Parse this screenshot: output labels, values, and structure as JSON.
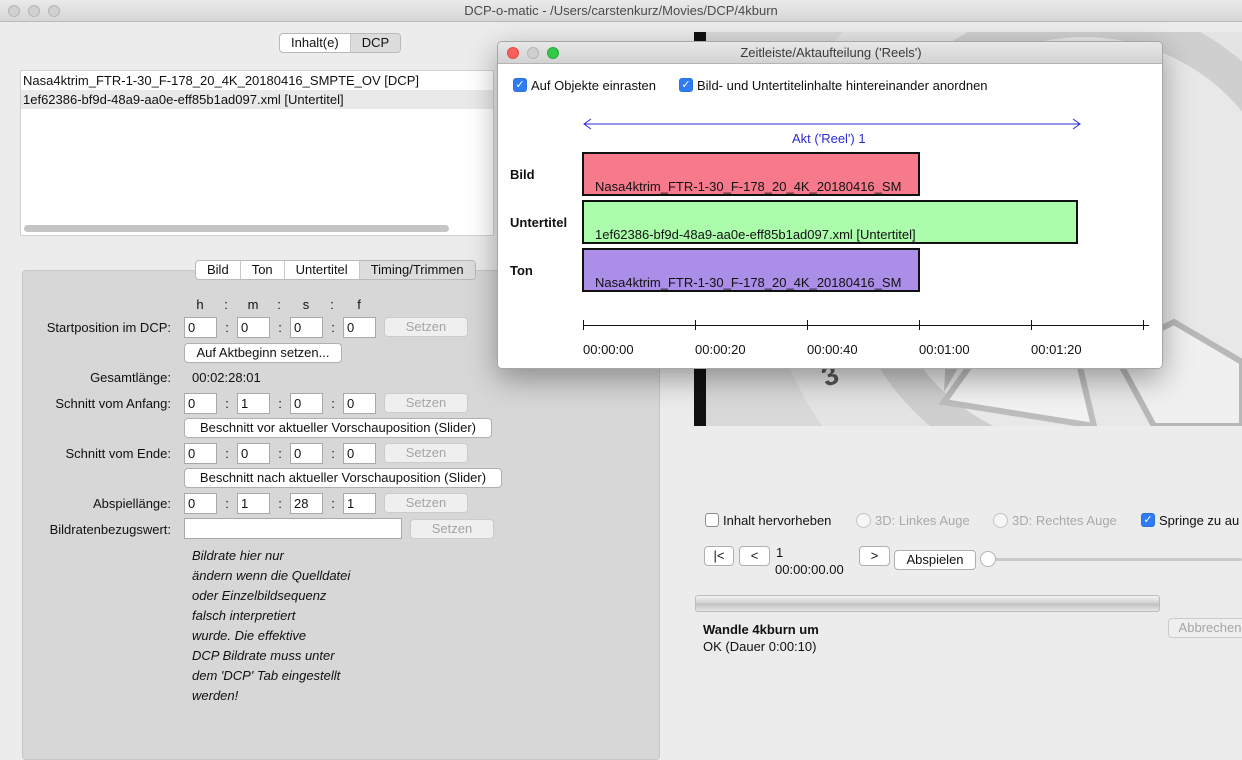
{
  "window": {
    "title": "DCP-o-matic - /Users/carstenkurz/Movies/DCP/4kburn"
  },
  "top_tabs": [
    "Inhalt(e)",
    "DCP"
  ],
  "content_list": [
    "Nasa4ktrim_FTR-1-30_F-178_20_4K_20180416_SMPTE_OV [DCP]",
    "1ef62386-bf9d-48a9-aa0e-eff85b1ad097.xml [Untertitel]"
  ],
  "content_tabs": [
    "Bild",
    "Ton",
    "Untertitel",
    "Timing/Trimmen"
  ],
  "timing": {
    "headers": [
      "h",
      "m",
      "s",
      "f"
    ],
    "start_label": "Startposition im DCP:",
    "start": [
      "0",
      "0",
      "0",
      "0"
    ],
    "set_button": "Setzen",
    "reel_start_button": "Auf Aktbeginn setzen...",
    "total_label": "Gesamtlänge:",
    "total_value": "00:02:28:01",
    "trim_start_label": "Schnitt vom Anfang:",
    "trim_start": [
      "0",
      "1",
      "0",
      "0"
    ],
    "trim_before_button": "Beschnitt vor aktueller Vorschauposition (Slider)",
    "trim_end_label": "Schnitt vom Ende:",
    "trim_end": [
      "0",
      "0",
      "0",
      "0"
    ],
    "trim_after_button": "Beschnitt nach aktueller Vorschauposition (Slider)",
    "play_length_label": "Abspiellänge:",
    "play_length": [
      "0",
      "1",
      "28",
      "1"
    ],
    "frame_rate_label": "Bildratenbezugswert:",
    "frame_rate_value": "",
    "help_lines": [
      "Bildrate hier nur",
      "ändern wenn die Quelldatei",
      "oder Einzelbildsequenz",
      "falsch interpretiert",
      "wurde. Die effektive",
      "DCP Bildrate muss unter",
      "dem 'DCP' Tab eingestellt",
      "werden!"
    ]
  },
  "playback": {
    "outline_label": "Inhalt hervorheben",
    "left_eye_label": "3D: Linkes Auge",
    "right_eye_label": "3D: Rechtes Auge",
    "jump_label": "Springe zu au",
    "btn_start": "|<",
    "btn_back": "<",
    "btn_fwd": ">",
    "play_button": "Abspielen",
    "frame_number": "1",
    "timecode": "00:00:00.00"
  },
  "job": {
    "title": "Wandle 4kburn um",
    "status": "OK (Dauer 0:00:10)",
    "cancel_button": "Abbrechen",
    "progress": 1.0
  },
  "dialog": {
    "title": "Zeitleiste/Aktaufteilung ('Reels')",
    "snap_label": "Auf Objekte einrasten",
    "sequence_label": "Bild- und Untertitelinhalte hintereinander anordnen",
    "reel_label": "Akt ('Reel') 1",
    "tracks": [
      {
        "label": "Bild",
        "clip": "Nasa4ktrim_FTR-1-30_F-178_20_4K_20180416_SM",
        "color": "#f77a8c"
      },
      {
        "label": "Untertitel",
        "clip": "1ef62386-bf9d-48a9-aa0e-eff85b1ad097.xml [Untertitel]",
        "color": "#abfdab"
      },
      {
        "label": "Ton",
        "clip": "Nasa4ktrim_FTR-1-30_F-178_20_4K_20180416_SM",
        "color": "#ab8ee8"
      }
    ],
    "ticks": [
      "00:00:00",
      "00:00:20",
      "00:00:40",
      "00:01:00",
      "00:01:20"
    ]
  }
}
